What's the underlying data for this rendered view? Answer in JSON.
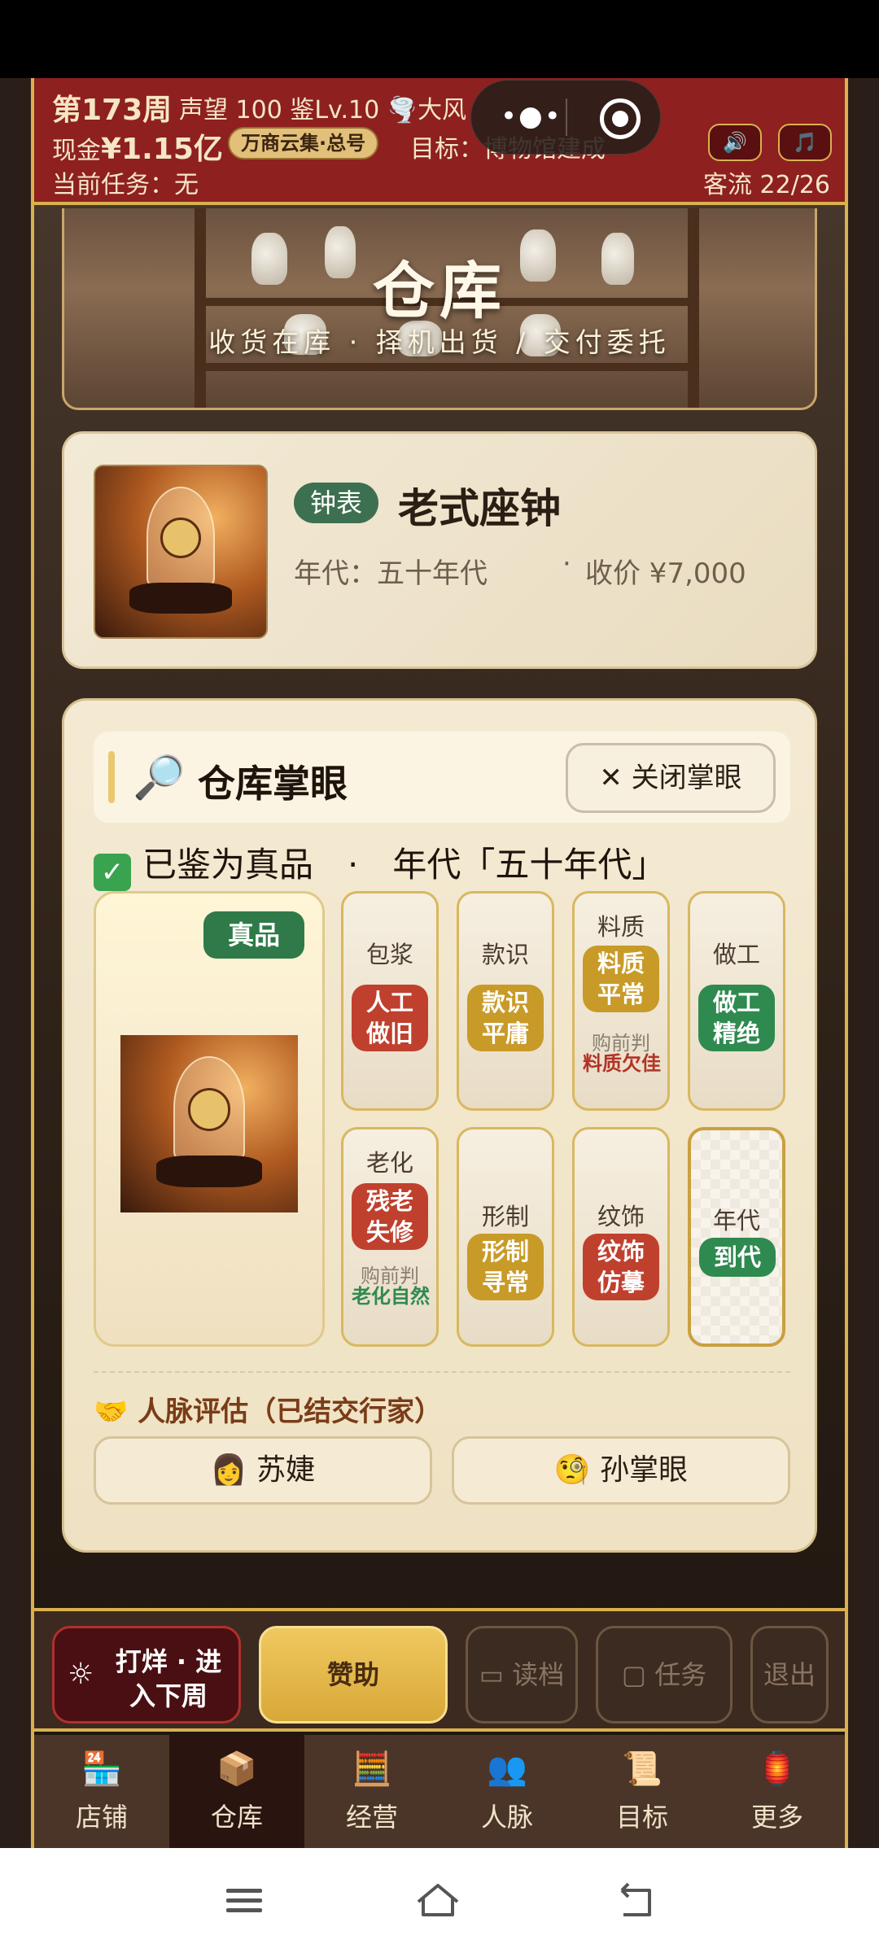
{
  "header": {
    "week": "第173周",
    "prestige_line": "声望 100 鉴Lv.10",
    "weather": "🌪️大风",
    "cash_label": "现金",
    "cash_value": "¥1.15亿",
    "alliance": "万商云集·总号",
    "goal": "目标：博物馆建成",
    "task": "当前任务：无",
    "footfall": "客流 22/26",
    "sound_icon": "🔊",
    "music_icon": "🎵"
  },
  "banner": {
    "title": "仓库",
    "subtitle": "收货在库 · 择机出货 / 交付委托"
  },
  "item": {
    "category": "钟表",
    "name": "老式座钟",
    "era": "年代：五十年代",
    "dot": "·",
    "price": "收价 ¥7,000"
  },
  "appraisal": {
    "title": "仓库掌眼",
    "close_label": "关闭掌眼",
    "verdict": "已鉴为真品　·　年代「五十年代」",
    "true_badge": "真品",
    "tiles": [
      {
        "label": "包浆",
        "chip": "人工\n做旧",
        "chip_color": "red"
      },
      {
        "label": "款识",
        "chip": "款识\n平庸",
        "chip_color": "gold"
      },
      {
        "label": "料质",
        "chip": "料质\n平常",
        "chip_color": "gold",
        "pre": "购前判",
        "pre_value": "料质欠佳",
        "pre_color": "red"
      },
      {
        "label": "做工",
        "chip": "做工\n精绝",
        "chip_color": "green"
      },
      {
        "label": "老化",
        "chip": "残老\n失修",
        "chip_color": "red",
        "pre": "购前判",
        "pre_value": "老化自然",
        "pre_color": "green"
      },
      {
        "label": "形制",
        "chip": "形制\n寻常",
        "chip_color": "gold"
      },
      {
        "label": "纹饰",
        "chip": "纹饰\n仿摹",
        "chip_color": "red"
      },
      {
        "label": "年代",
        "chip": "到代",
        "chip_color": "green"
      }
    ]
  },
  "relations": {
    "title": "🤝 人脉评估（已结交行家）",
    "people": [
      "👩 苏婕",
      "🧐 孙掌眼"
    ]
  },
  "actions": {
    "next_week": "打烊 · 进入下周",
    "sponsor": "赞助",
    "load": "读档",
    "tasks": "任务",
    "quit": "退出"
  },
  "tabs": [
    {
      "label": "店铺",
      "icon": "🏪"
    },
    {
      "label": "仓库",
      "icon": "📦"
    },
    {
      "label": "经营",
      "icon": "🧮"
    },
    {
      "label": "人脉",
      "icon": "👥"
    },
    {
      "label": "目标",
      "icon": "📜"
    },
    {
      "label": "更多",
      "icon": "🏮"
    }
  ],
  "active_tab": "仓库"
}
